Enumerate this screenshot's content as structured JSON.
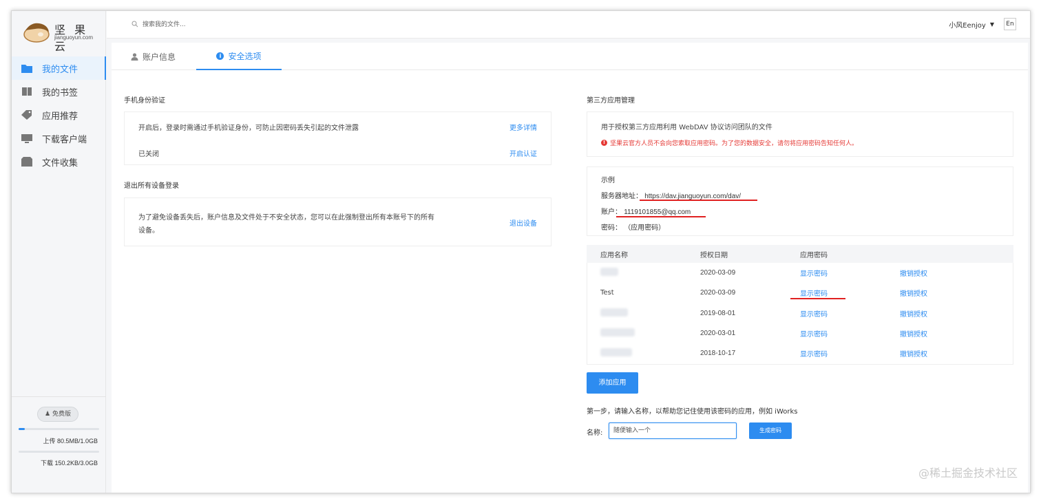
{
  "app": {
    "logo_cn": "坚 果 云",
    "logo_en": "jianguoyun.com"
  },
  "sidebar": {
    "items": [
      {
        "label": "我的文件",
        "icon": "folder-icon",
        "active": true
      },
      {
        "label": "我的书签",
        "icon": "bookmark-icon",
        "active": false
      },
      {
        "label": "应用推荐",
        "icon": "tag-icon",
        "active": false
      },
      {
        "label": "下载客户端",
        "icon": "monitor-icon",
        "active": false
      },
      {
        "label": "文件收集",
        "icon": "box-icon",
        "active": false
      }
    ],
    "plan_label": "免费版",
    "upload_text": "上传 80.5MB/1.0GB",
    "upload_progress": 0.08,
    "download_text": "下载 150.2KB/3.0GB",
    "download_progress": 0.0
  },
  "header": {
    "search_placeholder": "搜索我的文件...",
    "user_name": "小风Eenjoy",
    "lang_label": "En"
  },
  "tabs": [
    {
      "label": "账户信息",
      "icon": "user-icon",
      "active": false
    },
    {
      "label": "安全选项",
      "icon": "info-icon",
      "active": true
    }
  ],
  "left": {
    "phone_title": "手机身份验证",
    "phone_desc": "开启后，登录时需通过手机验证身份，可防止因密码丢失引起的文件泄露",
    "phone_more": "更多详情",
    "phone_status": "已关闭",
    "phone_enable": "开启认证",
    "logout_title": "退出所有设备登录",
    "logout_desc_1": "为了避免设备丢失后，账户信息及文件处于不安全状态，您可以在此强制登出所有本账号下的所有",
    "logout_desc_2": "设备。",
    "logout_link": "退出设备"
  },
  "right": {
    "title": "第三方应用管理",
    "desc": "用于授权第三方应用利用 WebDAV 协议访问团队的文件",
    "warning": "坚果云官方人员不会向您索取应用密码。为了您的数据安全，请勿将应用密码告知任何人。",
    "example_title": "示例",
    "server_label": "服务器地址：",
    "server_value": "https://dav.jianguoyun.com/dav/",
    "account_label": "账户：",
    "account_value": "1119101855@qq.com",
    "password_label": "密码：",
    "password_value": "（应用密码）",
    "table_headers": [
      "应用名称",
      "授权日期",
      "应用密码"
    ],
    "apps": [
      {
        "name": "",
        "date": "2020-03-09",
        "show": "显示密码",
        "revoke": "撤销授权"
      },
      {
        "name": "Test",
        "date": "2020-03-09",
        "show": "显示密码",
        "revoke": "撤销授权"
      },
      {
        "name": "",
        "date": "2019-08-01",
        "show": "显示密码",
        "revoke": "撤销授权"
      },
      {
        "name": "",
        "date": "2020-03-01",
        "show": "显示密码",
        "revoke": "撤销授权"
      },
      {
        "name": "",
        "date": "2018-10-17",
        "show": "显示密码",
        "revoke": "撤销授权"
      }
    ],
    "add_button": "添加应用",
    "step_text": "第一步，请输入名称，以帮助您记住使用该密码的应用，例如 iWorks",
    "name_label": "名称:",
    "name_input_value": "随便输入一个",
    "generate_button": "生成密码"
  },
  "watermark": "@稀土掘金技术社区",
  "colors": {
    "accent": "#2d8cf0",
    "warning": "#e53935",
    "annotation": "#e02020"
  }
}
